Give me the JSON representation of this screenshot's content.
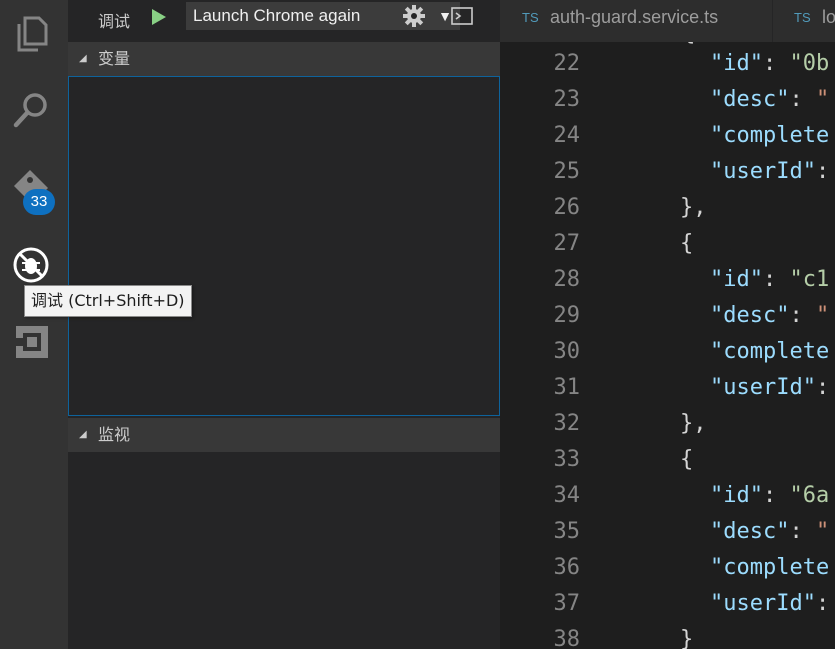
{
  "activity_bar": {
    "badge_count": "33",
    "tooltip": "调试 (Ctrl+Shift+D)"
  },
  "debug_toolbar": {
    "title": "调试",
    "config_value": "Launch Chrome again",
    "caret": "▼"
  },
  "sections": {
    "variables": "变量",
    "watch": "监视"
  },
  "tabs": [
    {
      "badge": "TS",
      "name": "auth-guard.service.ts"
    },
    {
      "badge": "TS",
      "name": "lo"
    }
  ],
  "editor": {
    "lines": [
      {
        "num": "22",
        "indent": "  ",
        "key": "\"id\"",
        "sep": ": ",
        "val": "\"0b",
        "vtype": "n"
      },
      {
        "num": "23",
        "indent": "  ",
        "key": "\"desc\"",
        "sep": ": ",
        "val": "\"",
        "vtype": "s"
      },
      {
        "num": "24",
        "indent": "  ",
        "key": "\"complete",
        "sep": "",
        "val": "",
        "vtype": "s"
      },
      {
        "num": "25",
        "indent": "  ",
        "key": "\"userId\"",
        "sep": ":",
        "val": "",
        "vtype": "s"
      },
      {
        "num": "26",
        "indent": "",
        "key": "",
        "sep": "},",
        "val": "",
        "vtype": "s"
      },
      {
        "num": "27",
        "indent": "",
        "key": "",
        "sep": "{",
        "val": "",
        "vtype": "s"
      },
      {
        "num": "28",
        "indent": "  ",
        "key": "\"id\"",
        "sep": ": ",
        "val": "\"c1",
        "vtype": "n"
      },
      {
        "num": "29",
        "indent": "  ",
        "key": "\"desc\"",
        "sep": ": ",
        "val": "\"",
        "vtype": "s"
      },
      {
        "num": "30",
        "indent": "  ",
        "key": "\"complete",
        "sep": "",
        "val": "",
        "vtype": "s"
      },
      {
        "num": "31",
        "indent": "  ",
        "key": "\"userId\"",
        "sep": ":",
        "val": "",
        "vtype": "s"
      },
      {
        "num": "32",
        "indent": "",
        "key": "",
        "sep": "},",
        "val": "",
        "vtype": "s"
      },
      {
        "num": "33",
        "indent": "",
        "key": "",
        "sep": "{",
        "val": "",
        "vtype": "s"
      },
      {
        "num": "34",
        "indent": "  ",
        "key": "\"id\"",
        "sep": ": ",
        "val": "\"6a",
        "vtype": "n"
      },
      {
        "num": "35",
        "indent": "  ",
        "key": "\"desc\"",
        "sep": ": ",
        "val": "\"",
        "vtype": "s"
      },
      {
        "num": "36",
        "indent": "  ",
        "key": "\"complete",
        "sep": "",
        "val": "",
        "vtype": "s"
      },
      {
        "num": "37",
        "indent": "  ",
        "key": "\"userId\"",
        "sep": ":",
        "val": "",
        "vtype": "s"
      },
      {
        "num": "38",
        "indent": "",
        "key": "",
        "sep": "}",
        "val": "",
        "vtype": "s"
      }
    ]
  }
}
